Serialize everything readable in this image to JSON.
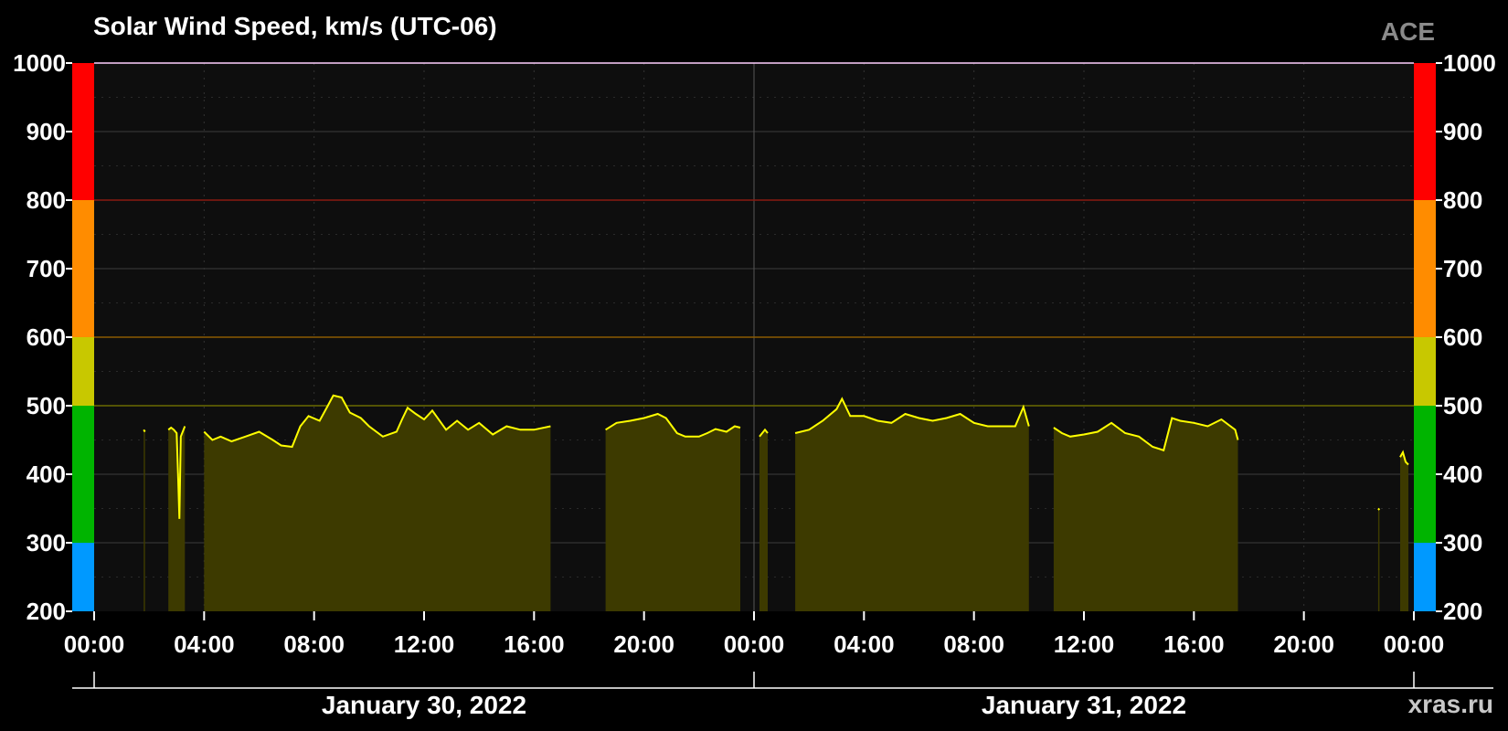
{
  "title": "Solar Wind Speed, km/s (UTC-06)",
  "source": "ACE",
  "credit": "xras.ru",
  "colors": {
    "background": "#000000",
    "plot_bg": "#0e0e0e",
    "line": "#ffff00",
    "fill": "#3d3a00",
    "grid": "#3c3c3c",
    "threshold_red": "#8a1a10",
    "threshold_orange": "#8a5a00",
    "threshold_yellow": "#6a6a00"
  },
  "chart_data": {
    "type": "area",
    "ylim": [
      200,
      1000
    ],
    "yticks": [
      "1000",
      "900",
      "800",
      "700",
      "600",
      "500",
      "400",
      "300",
      "200"
    ],
    "xticks": [
      "00:00",
      "04:00",
      "08:00",
      "12:00",
      "16:00",
      "20:00",
      "00:00",
      "04:00",
      "08:00",
      "12:00",
      "16:00",
      "20:00",
      "00:00"
    ],
    "xlim_hours": [
      0,
      48
    ],
    "days": [
      "January 30, 2022",
      "January 31, 2022"
    ],
    "scale_bands": [
      {
        "from": 200,
        "to": 300,
        "color": "#0099ff"
      },
      {
        "from": 300,
        "to": 500,
        "color": "#00b400"
      },
      {
        "from": 500,
        "to": 600,
        "color": "#c8c800"
      },
      {
        "from": 600,
        "to": 800,
        "color": "#ff8c00"
      },
      {
        "from": 800,
        "to": 1000,
        "color": "#ff0000"
      }
    ],
    "thresholds": [
      500,
      600,
      800
    ],
    "series": [
      {
        "segments": [
          [
            [
              1.8,
              465
            ],
            [
              1.85,
              462
            ]
          ],
          [
            [
              2.7,
              465
            ],
            [
              2.8,
              468
            ],
            [
              2.9,
              465
            ],
            [
              3.0,
              460
            ],
            [
              3.05,
              400
            ],
            [
              3.1,
              335
            ],
            [
              3.15,
              455
            ],
            [
              3.3,
              470
            ]
          ],
          [
            [
              4.0,
              462
            ],
            [
              4.3,
              450
            ],
            [
              4.6,
              455
            ],
            [
              5.0,
              448
            ],
            [
              5.5,
              455
            ],
            [
              6.0,
              462
            ],
            [
              6.5,
              450
            ],
            [
              6.8,
              442
            ],
            [
              7.2,
              440
            ],
            [
              7.5,
              470
            ],
            [
              7.8,
              485
            ],
            [
              8.2,
              478
            ],
            [
              8.5,
              500
            ],
            [
              8.7,
              515
            ],
            [
              9.0,
              512
            ],
            [
              9.3,
              490
            ],
            [
              9.7,
              482
            ],
            [
              10.0,
              470
            ],
            [
              10.5,
              455
            ],
            [
              11.0,
              462
            ],
            [
              11.2,
              480
            ],
            [
              11.4,
              497
            ],
            [
              11.7,
              488
            ],
            [
              12.0,
              480
            ],
            [
              12.3,
              493
            ],
            [
              12.8,
              465
            ],
            [
              13.2,
              478
            ],
            [
              13.6,
              465
            ],
            [
              14.0,
              475
            ],
            [
              14.5,
              458
            ],
            [
              15.0,
              470
            ],
            [
              15.5,
              465
            ],
            [
              16.0,
              465
            ],
            [
              16.6,
              470
            ]
          ],
          [
            [
              18.6,
              465
            ],
            [
              19.0,
              475
            ],
            [
              19.5,
              478
            ],
            [
              20.0,
              482
            ],
            [
              20.5,
              488
            ],
            [
              20.8,
              482
            ],
            [
              21.2,
              460
            ],
            [
              21.5,
              455
            ],
            [
              22.0,
              455
            ],
            [
              22.3,
              460
            ],
            [
              22.6,
              466
            ],
            [
              23.0,
              462
            ],
            [
              23.3,
              470
            ],
            [
              23.5,
              468
            ]
          ],
          [
            [
              24.2,
              455
            ],
            [
              24.4,
              465
            ],
            [
              24.5,
              460
            ]
          ],
          [
            [
              25.5,
              460
            ],
            [
              26.0,
              465
            ],
            [
              26.5,
              478
            ],
            [
              27.0,
              495
            ],
            [
              27.2,
              510
            ],
            [
              27.5,
              485
            ],
            [
              28.0,
              485
            ],
            [
              28.5,
              478
            ],
            [
              29.0,
              475
            ],
            [
              29.5,
              488
            ],
            [
              30.0,
              482
            ],
            [
              30.5,
              478
            ],
            [
              31.0,
              482
            ],
            [
              31.5,
              488
            ],
            [
              32.0,
              475
            ],
            [
              32.5,
              470
            ],
            [
              33.0,
              470
            ],
            [
              33.5,
              470
            ],
            [
              33.8,
              498
            ],
            [
              34.0,
              470
            ]
          ],
          [
            [
              34.9,
              468
            ],
            [
              35.2,
              460
            ],
            [
              35.5,
              455
            ],
            [
              36.0,
              458
            ],
            [
              36.5,
              462
            ],
            [
              37.0,
              475
            ],
            [
              37.5,
              460
            ],
            [
              38.0,
              455
            ],
            [
              38.5,
              440
            ],
            [
              38.9,
              435
            ],
            [
              39.2,
              482
            ],
            [
              39.5,
              478
            ],
            [
              40.0,
              475
            ],
            [
              40.5,
              470
            ],
            [
              41.0,
              480
            ],
            [
              41.5,
              465
            ],
            [
              41.6,
              450
            ]
          ],
          [
            [
              46.7,
              350
            ],
            [
              46.75,
              348
            ]
          ],
          [
            [
              47.5,
              425
            ],
            [
              47.6,
              432
            ],
            [
              47.7,
              418
            ],
            [
              47.8,
              414
            ]
          ]
        ]
      }
    ]
  }
}
